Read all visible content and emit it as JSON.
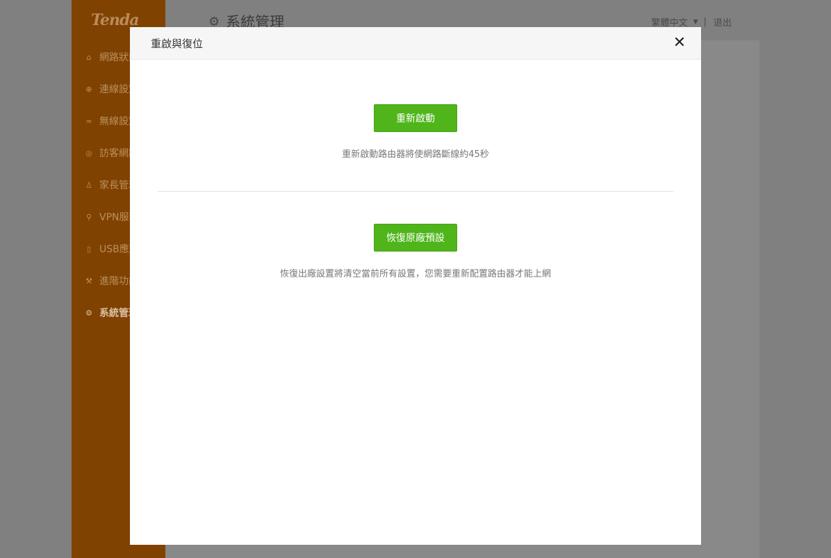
{
  "app": {
    "logo": "Tenda",
    "title": "系統管理",
    "title_icon": "gear-icon",
    "language": "繁體中文",
    "divider": "|",
    "logout": "退出"
  },
  "sidebar": {
    "items": [
      {
        "label": "網路狀態",
        "icon": "router-icon"
      },
      {
        "label": "連線設定",
        "icon": "globe-icon"
      },
      {
        "label": "無線設定",
        "icon": "wifi-icon"
      },
      {
        "label": "訪客網路",
        "icon": "guest-icon"
      },
      {
        "label": "家長管理",
        "icon": "family-icon"
      },
      {
        "label": "VPN服務",
        "icon": "vpn-icon"
      },
      {
        "label": "USB應用",
        "icon": "usb-icon"
      },
      {
        "label": "進階功能",
        "icon": "wrench-icon"
      },
      {
        "label": "系統管理",
        "icon": "gear-icon",
        "active": true
      }
    ]
  },
  "modal": {
    "title": "重啟與復位",
    "reboot_button": "重新啟動",
    "reboot_hint": "重新啟動路由器將使網路斷線約45秒",
    "reset_button": "恢復原廠預設",
    "reset_hint": "恢復出廠設置將清空當前所有設置，您需要重新配置路由器才能上網"
  },
  "colors": {
    "overlay": "#808080",
    "sidebar": "#804200",
    "button_green": "#4fb51a"
  }
}
